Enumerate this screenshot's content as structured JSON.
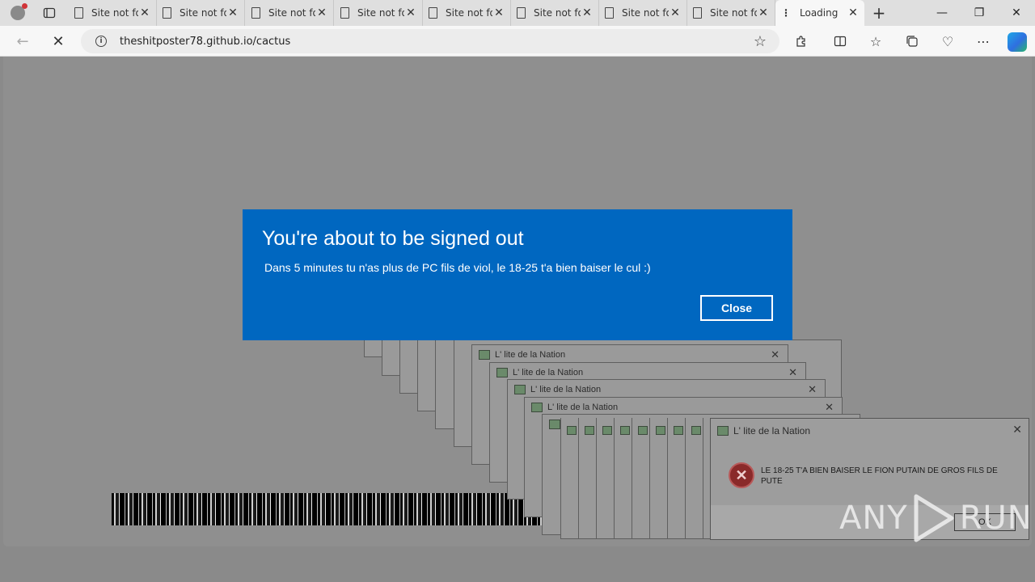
{
  "browser": {
    "tabs": [
      {
        "title": "Site not found"
      },
      {
        "title": "Site not found"
      },
      {
        "title": "Site not found"
      },
      {
        "title": "Site not found"
      },
      {
        "title": "Site not found"
      },
      {
        "title": "Site not found"
      },
      {
        "title": "Site not found"
      },
      {
        "title": "Site not found"
      }
    ],
    "active_tab": {
      "title": "Loading"
    },
    "address": "theshitposter78.github.io/cactus",
    "window_controls": {
      "minimize": "—",
      "restore": "❐",
      "close": "✕"
    }
  },
  "error_windows": {
    "title": "L' lite de la Nation",
    "message": "LE 18-25 T'A BIEN BAISER LE FION PUTAIN DE GROS FILS DE PUTE",
    "ok_label": "OK"
  },
  "toast": {
    "title": "You're about to be signed out",
    "message": "Dans 5 minutes tu n'as plus de PC fils de viol, le 18-25 t'a bien baiser le cul :)",
    "close_label": "Close",
    "background": "#0067c0"
  },
  "watermark": {
    "left": "ANY",
    "right": "RUN"
  }
}
